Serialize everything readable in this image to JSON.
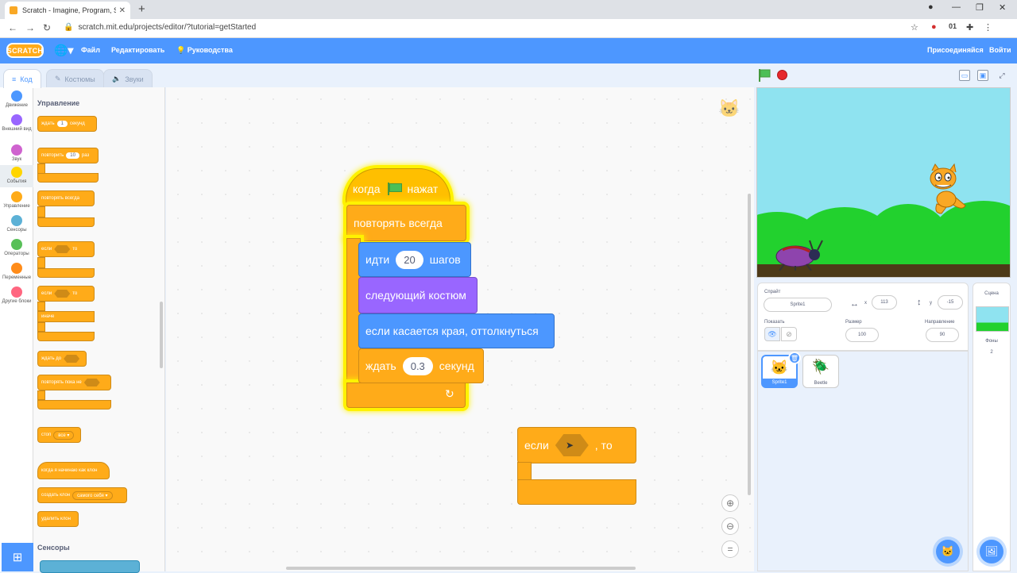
{
  "browser": {
    "tab_title": "Scratch - Imagine, Program, Sha",
    "url": "scratch.mit.edu/projects/editor/?tutorial=getStarted"
  },
  "menubar": {
    "logo": "SCRATCH",
    "file": "Файл",
    "edit": "Редактировать",
    "tutorials": "Руководства",
    "join": "Присоединяйся",
    "signin": "Войти"
  },
  "tabs": {
    "code": "Код",
    "costumes": "Костюмы",
    "sounds": "Звуки"
  },
  "categories": [
    {
      "label": "Движение",
      "color": "#4c97ff"
    },
    {
      "label": "Внешний вид",
      "color": "#9966ff"
    },
    {
      "label": "Звук",
      "color": "#cf63cf"
    },
    {
      "label": "События",
      "color": "#ffd500"
    },
    {
      "label": "Управление",
      "color": "#ffab19"
    },
    {
      "label": "Сенсоры",
      "color": "#5cb1d6"
    },
    {
      "label": "Операторы",
      "color": "#59c059"
    },
    {
      "label": "Переменные",
      "color": "#ff8c1a"
    },
    {
      "label": "Другие блоки",
      "color": "#ff6680"
    }
  ],
  "palette": {
    "section_control": "Управление",
    "wait": "ждать",
    "wait_value": "1",
    "wait_unit": "секунд",
    "repeat": "повторить",
    "repeat_value": "10",
    "repeat_unit": "раз",
    "forever": "повторять всегда",
    "if": "если",
    "then": "то",
    "else": "иначе",
    "wait_until": "ждать до",
    "repeat_until": "повторять пока не",
    "stop": "стоп",
    "stop_value": "все",
    "when_clone": "когда я начинаю как клон",
    "create_clone": "создать клон",
    "create_clone_value": "самого себя",
    "delete_clone": "удалить клон",
    "section_sensing": "Сенсоры"
  },
  "script": {
    "when": "когда",
    "clicked": "нажат",
    "forever": "повторять всегда",
    "move": "идти",
    "move_value": "20",
    "move_unit": "шагов",
    "next_costume": "следующий костюм",
    "bounce": "если касается края, оттолкнуться",
    "wait": "ждать",
    "wait_value": "0.3",
    "wait_unit": "секунд"
  },
  "if_block": {
    "if": "если",
    "then": ", то"
  },
  "sprite_info": {
    "sprite_label": "Спрайт",
    "sprite_name": "Sprite1",
    "x_label": "x",
    "x_value": "113",
    "y_label": "y",
    "y_value": "-15",
    "show_label": "Показать",
    "size_label": "Размер",
    "size_value": "100",
    "direction_label": "Направление",
    "direction_value": "90"
  },
  "sprites": [
    {
      "name": "Sprite1"
    },
    {
      "name": "Beetle"
    }
  ],
  "stage_panel": {
    "title": "Сцена",
    "backdrops_label": "Фоны",
    "backdrops_count": "2"
  }
}
